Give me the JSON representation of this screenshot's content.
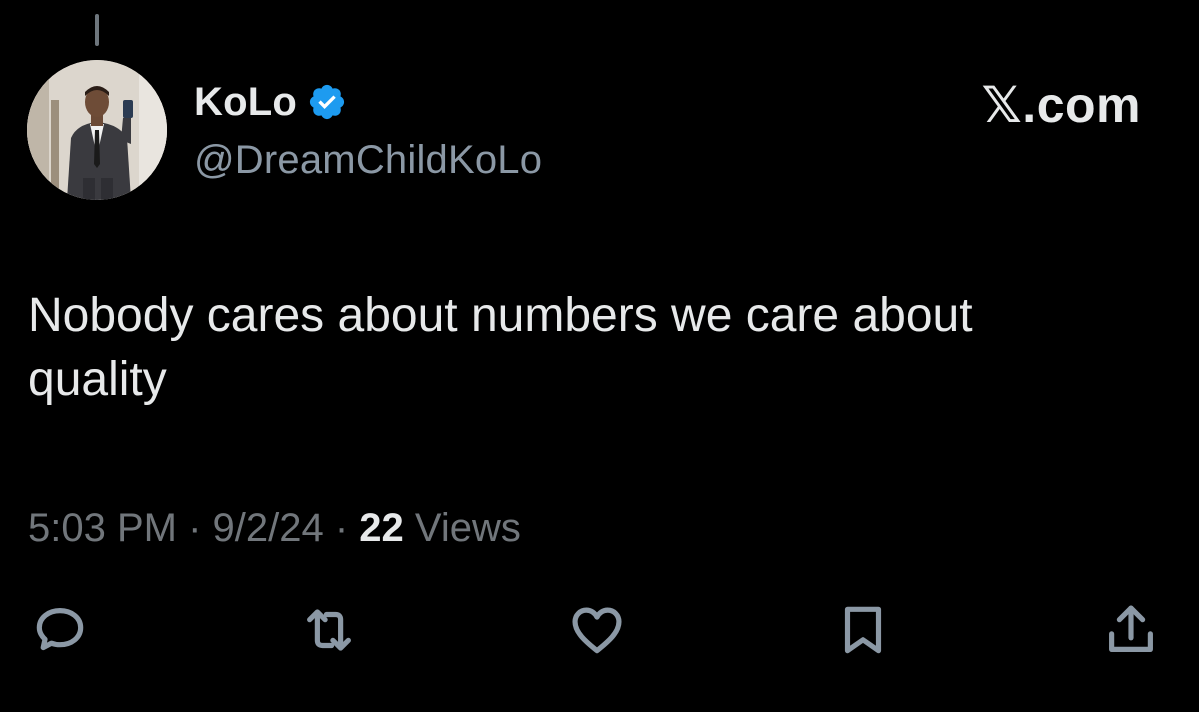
{
  "author": {
    "display_name": "KoLo",
    "handle": "@DreamChildKoLo",
    "verified_icon": "verified-badge-icon",
    "verified_color": "#1d9bf0"
  },
  "brand": {
    "label": "𝕏.com"
  },
  "tweet": {
    "text": "Nobody cares about numbers we care about\nquality"
  },
  "meta": {
    "time": "5:03 PM",
    "sep1": " · ",
    "date": "9/2/24",
    "sep2": " · ",
    "views_count": "22",
    "views_label": " Views"
  },
  "actions": [
    {
      "icon": "reply-icon"
    },
    {
      "icon": "retweet-icon"
    },
    {
      "icon": "like-icon"
    },
    {
      "icon": "bookmark-icon"
    },
    {
      "icon": "share-icon"
    }
  ],
  "colors": {
    "background": "#000000",
    "primary_text": "#e7e9ea",
    "secondary_text": "#71767b",
    "icon": "#8b98a5"
  }
}
